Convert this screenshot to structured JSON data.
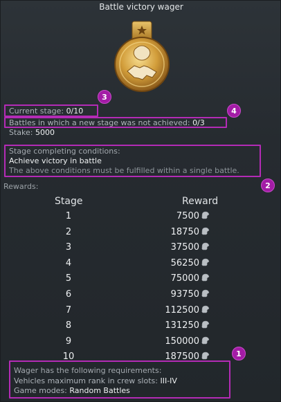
{
  "window": {
    "title": "Battle victory wager"
  },
  "stats": {
    "current_stage_label": "Current stage:",
    "current_stage_value": "0/10",
    "battles_label": "Battles in which a new stage was not achieved:",
    "battles_value": "0/3",
    "stake_label": "Stake:",
    "stake_value": "5000"
  },
  "conditions": {
    "header": "Stage completing conditions:",
    "main": "Achieve victory in battle",
    "note": "The above conditions must be fulfilled within a single battle."
  },
  "rewards": {
    "label": "Rewards:",
    "col_stage": "Stage",
    "col_reward": "Reward",
    "rows": [
      {
        "stage": "1",
        "reward": "7500"
      },
      {
        "stage": "2",
        "reward": "18750"
      },
      {
        "stage": "3",
        "reward": "37500"
      },
      {
        "stage": "4",
        "reward": "56250"
      },
      {
        "stage": "5",
        "reward": "75000"
      },
      {
        "stage": "6",
        "reward": "93750"
      },
      {
        "stage": "7",
        "reward": "112500"
      },
      {
        "stage": "8",
        "reward": "131250"
      },
      {
        "stage": "9",
        "reward": "150000"
      },
      {
        "stage": "10",
        "reward": "187500"
      }
    ],
    "currency_icon": "silver-lion-icon"
  },
  "requirements": {
    "header": "Wager has the following requirements:",
    "rank_label": "Vehicles maximum rank in crew slots:",
    "rank_value": "III-IV",
    "modes_label": "Game modes:",
    "modes_value": "Random Battles"
  },
  "annotations": [
    "1",
    "2",
    "3",
    "4"
  ],
  "colors": {
    "highlight": "#b42bb6",
    "badge": "#a31ca6",
    "medal_gold": "#d7a640"
  }
}
